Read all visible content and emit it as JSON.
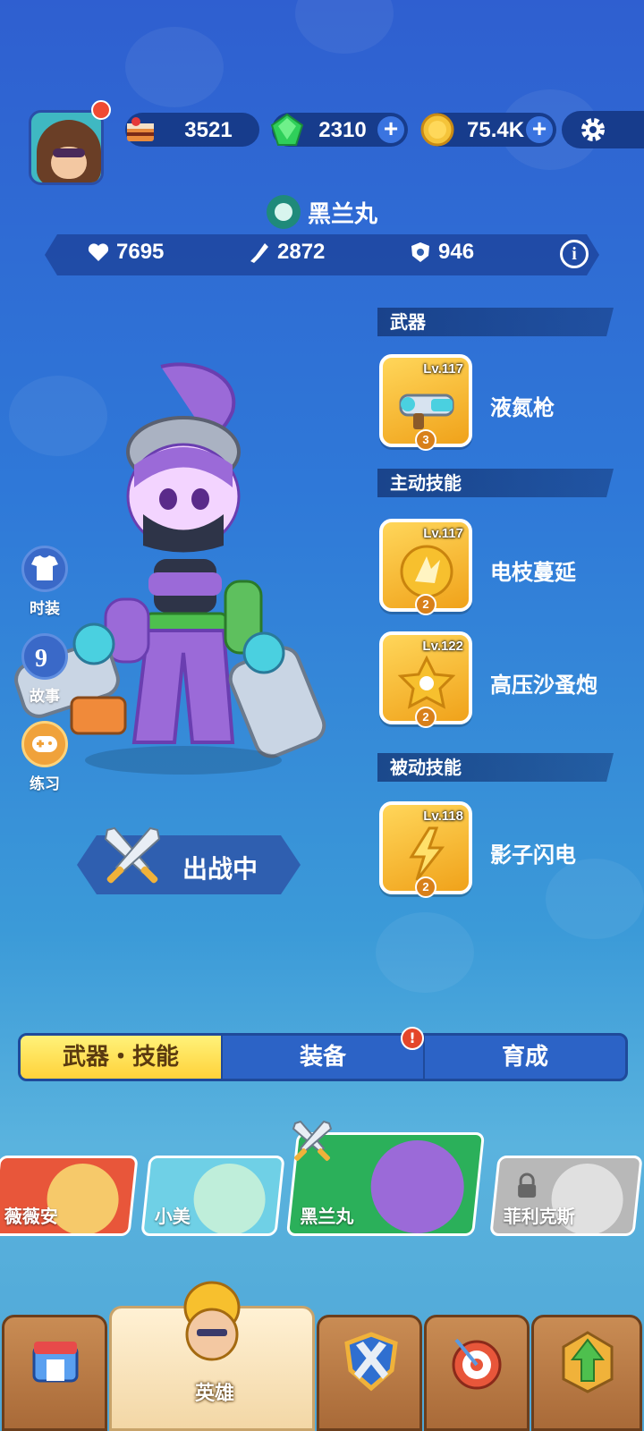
{
  "profile": {
    "has_notification": true
  },
  "resources": [
    {
      "icon": "cake-icon",
      "value": "3521",
      "has_plus": false
    },
    {
      "icon": "gem-icon",
      "value": "2310",
      "has_plus": true
    },
    {
      "icon": "coin-icon",
      "value": "75.4K",
      "has_plus": true
    }
  ],
  "hero": {
    "name": "黑兰丸",
    "stats": {
      "health": "7695",
      "attack": "2872",
      "defense": "946"
    }
  },
  "sections": {
    "weapon": "武器",
    "active_skills": "主动技能",
    "passive_skills": "被动技能"
  },
  "skills": [
    {
      "level": "Lv.117",
      "stars": "3",
      "name": "液氮枪",
      "icon": "freeze-gun-icon"
    },
    {
      "level": "Lv.117",
      "stars": "2",
      "name": "电枝蔓延",
      "icon": "lightning-burst-icon"
    },
    {
      "level": "Lv.122",
      "stars": "2",
      "name": "高压沙蚤炮",
      "icon": "flea-cannon-icon"
    },
    {
      "level": "Lv.118",
      "stars": "2",
      "name": "影子闪电",
      "icon": "shadow-lightning-icon"
    }
  ],
  "side_menu": [
    {
      "label": "时装",
      "icon": "shirt-icon"
    },
    {
      "label": "故事",
      "icon": "story-icon"
    },
    {
      "label": "练习",
      "icon": "gamepad-icon"
    }
  ],
  "battle_status": "出战中",
  "tabs": [
    {
      "label": "武器・技能",
      "active": true
    },
    {
      "label": "装备",
      "active": false,
      "alert": "!"
    },
    {
      "label": "育成",
      "active": false
    }
  ],
  "hero_list": [
    {
      "name": "薇薇安",
      "color": "#e8563a",
      "locked": false
    },
    {
      "name": "小美",
      "color": "#6fd0e6",
      "locked": false
    },
    {
      "name": "黑兰丸",
      "color": "#2bb05a",
      "locked": false,
      "selected": true
    },
    {
      "name": "菲利克斯",
      "color": "#b8b8b8",
      "locked": true
    }
  ],
  "bottom_nav": [
    {
      "icon": "shop-icon",
      "label": ""
    },
    {
      "icon": "hero-icon",
      "label": "英雄",
      "active": true
    },
    {
      "icon": "battle-shield-icon",
      "label": ""
    },
    {
      "icon": "target-icon",
      "label": ""
    },
    {
      "icon": "upgrade-arrow-icon",
      "label": ""
    }
  ]
}
